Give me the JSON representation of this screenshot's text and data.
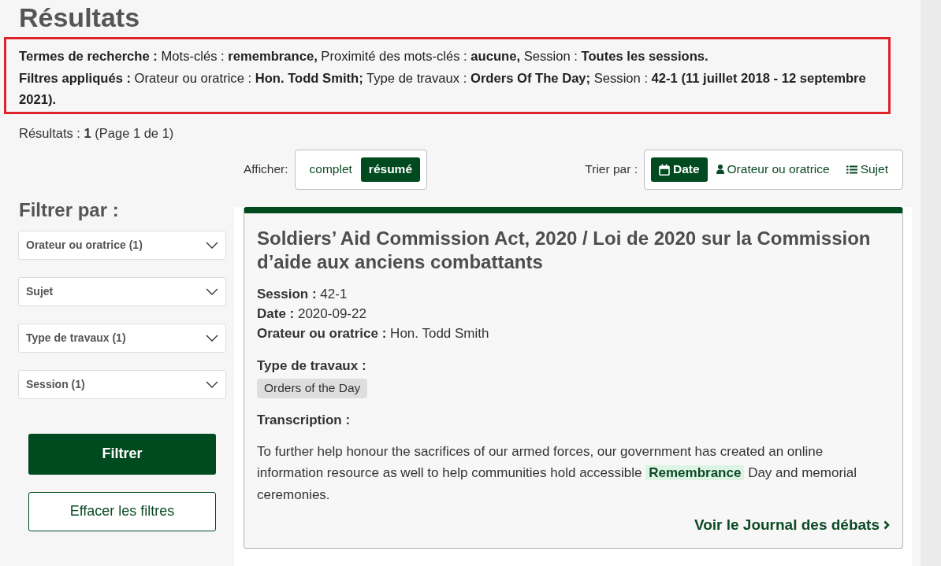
{
  "page_title": "Résultats",
  "search_summary": [
    "**Termes de recherche :** Mots-clés : **remembrance,** Proximité des mots-clés : **aucune,** Session : **Toutes les sessions.**",
    "**Filtres appliqués :** Orateur ou oratrice : **Hon. Todd Smith;** Type de travaux : **Orders Of The Day;** Session : **42-1 (11 juillet 2018 - 12 septembre 2021).**"
  ],
  "result_count": "Résultats : **1** (Page 1 de 1)",
  "display": {
    "label": "Afficher:",
    "options": [
      {
        "label": "complet",
        "selected": false
      },
      {
        "label": "résumé",
        "selected": true
      }
    ]
  },
  "sort": {
    "label": "Trier par :",
    "options": [
      {
        "label": "Date",
        "kind": "date",
        "selected": true
      },
      {
        "label": "Orateur ou oratrice",
        "kind": "speaker",
        "selected": false
      },
      {
        "label": "Sujet",
        "kind": "subject",
        "selected": false
      }
    ]
  },
  "filter_panel": {
    "heading": "Filtrer par :",
    "dropdowns": [
      "Orateur ou oratrice (1)",
      "Sujet",
      "Type de travaux (1)",
      "Session (1)"
    ],
    "apply_button": "Filtrer",
    "clear_button": "Effacer les filtres"
  },
  "result": {
    "title": "Soldiers’ Aid Commission Act, 2020 / Loi de 2020 sur la Commission d’aide aux anciens combattants",
    "details": [
      "**Session :** 42-1",
      "**Date :** 2020-09-22",
      "**Orateur ou oratrice :** Hon. Todd Smith"
    ],
    "type_label": "Type de travaux :",
    "tags": [
      "Orders of the Day"
    ],
    "transcript_label": "Transcription :",
    "excerpt": "To further help honour the sacrifices of our armed forces, our government has created an online information resource as well to help communities hold accessible **Remembrance** Day and memorial ceremonies.",
    "link": "Voir le Journal des débats"
  }
}
